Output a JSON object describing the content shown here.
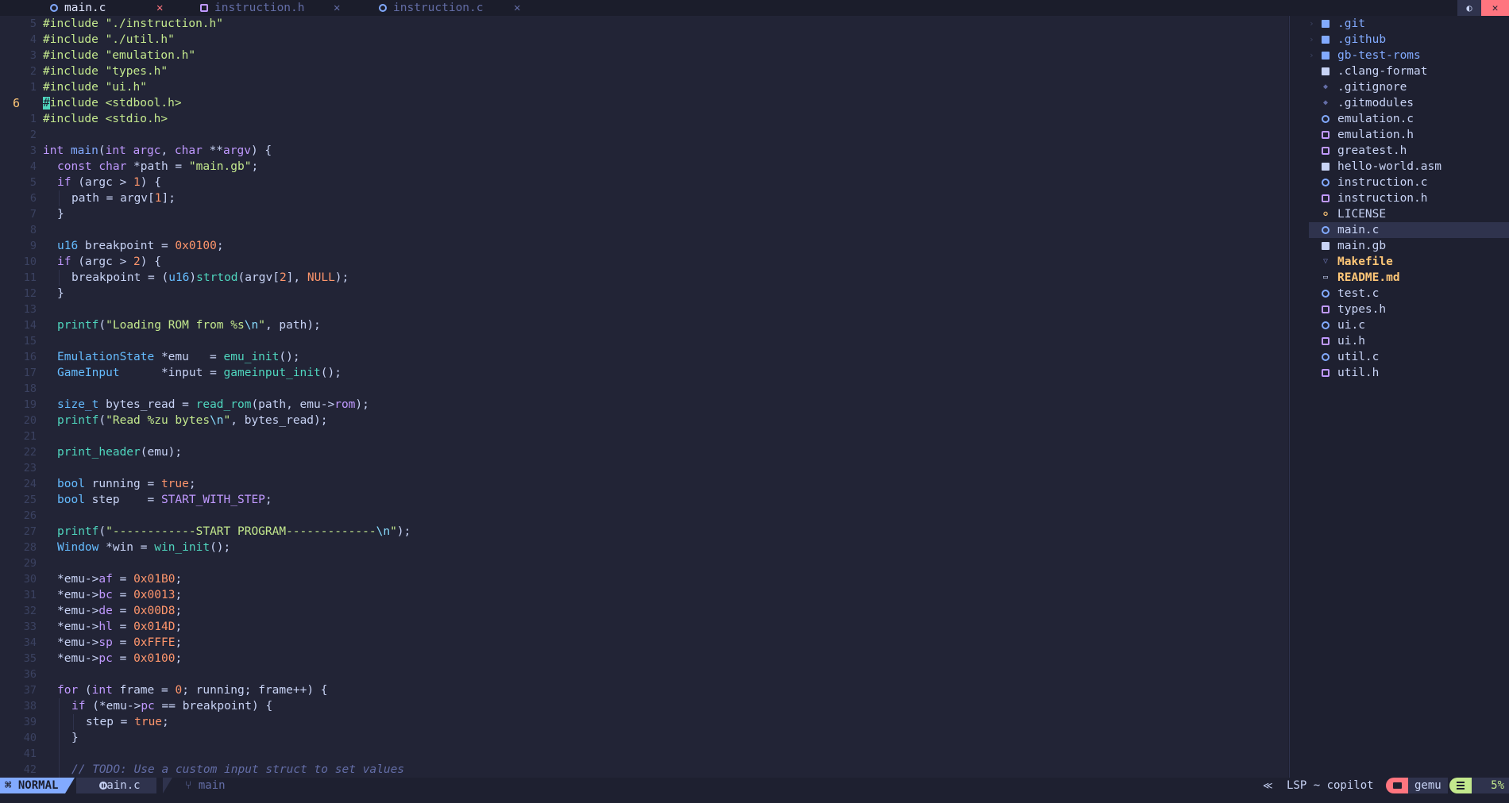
{
  "tabs": [
    {
      "label": "main.c",
      "close": "✕"
    },
    {
      "label": "instruction.h",
      "close": "✕"
    },
    {
      "label": "instruction.c",
      "close": "✕"
    }
  ],
  "tabline_buttons": [
    "◐",
    "✕"
  ],
  "current_line_number": "6",
  "gutter": [
    "5",
    "4",
    "3",
    "2",
    "1",
    "6",
    "1",
    "2",
    "3",
    "4",
    "5",
    "6",
    "7",
    "8",
    "9",
    "10",
    "11",
    "12",
    "13",
    "14",
    "15",
    "16",
    "17",
    "18",
    "19",
    "20",
    "21",
    "22",
    "23",
    "24",
    "25",
    "26",
    "27",
    "28",
    "29",
    "30",
    "31",
    "32",
    "33",
    "34",
    "35",
    "36",
    "37",
    "38",
    "39",
    "40",
    "41",
    "42"
  ],
  "code": {
    "l0": [
      "#include ",
      "\"./instruction.h\""
    ],
    "l1": [
      "#include ",
      "\"./util.h\""
    ],
    "l2": [
      "#include ",
      "\"emulation.h\""
    ],
    "l3": [
      "#include ",
      "\"types.h\""
    ],
    "l4": [
      "#include ",
      "\"ui.h\""
    ],
    "l5": [
      "#",
      "include ",
      "<stdbool.h>"
    ],
    "l6": [
      "#include ",
      "<stdio.h>"
    ],
    "l8": [
      "int",
      " ",
      "main",
      "(",
      "int",
      " ",
      "argc",
      ", ",
      "char",
      " **",
      "argv",
      ") {"
    ],
    "l9": [
      "const",
      " ",
      "char",
      " *path = ",
      "\"main.gb\"",
      ";"
    ],
    "l10": [
      "if",
      " (argc > ",
      "1",
      ") {"
    ],
    "l11": [
      "path = argv[",
      "1",
      "];"
    ],
    "l12": [
      "}"
    ],
    "l14": [
      "u16",
      " breakpoint = ",
      "0x0100",
      ";"
    ],
    "l15": [
      "if",
      " (argc > ",
      "2",
      ") {"
    ],
    "l16": [
      "breakpoint = (",
      "u16",
      ")",
      "strtod",
      "(argv[",
      "2",
      "], ",
      "NULL",
      ");"
    ],
    "l17": [
      "}"
    ],
    "l19": [
      "printf",
      "(",
      "\"Loading ROM from %s",
      "\\n",
      "\"",
      ", path);"
    ],
    "l21": [
      "EmulationState",
      " *emu   = ",
      "emu_init",
      "();"
    ],
    "l22": [
      "GameInput",
      "      *input = ",
      "gameinput_init",
      "();"
    ],
    "l24": [
      "size_t",
      " bytes_read = ",
      "read_rom",
      "(path, emu->",
      "rom",
      ");"
    ],
    "l25": [
      "printf",
      "(",
      "\"Read %zu bytes",
      "\\n",
      "\"",
      ", bytes_read);"
    ],
    "l27": [
      "print_header",
      "(emu);"
    ],
    "l29": [
      "bool",
      " running = ",
      "true",
      ";"
    ],
    "l30": [
      "bool",
      " step    = ",
      "START_WITH_STEP",
      ";"
    ],
    "l32": [
      "printf",
      "(",
      "\"------------START PROGRAM-------------",
      "\\n",
      "\"",
      ");"
    ],
    "l33": [
      "Window",
      " *win = ",
      "win_init",
      "();"
    ],
    "l35": [
      "*emu->",
      "af",
      " = ",
      "0x01B0",
      ";"
    ],
    "l36": [
      "*emu->",
      "bc",
      " = ",
      "0x0013",
      ";"
    ],
    "l37": [
      "*emu->",
      "de",
      " = ",
      "0x00D8",
      ";"
    ],
    "l38": [
      "*emu->",
      "hl",
      " = ",
      "0x014D",
      ";"
    ],
    "l39": [
      "*emu->",
      "sp",
      " = ",
      "0xFFFE",
      ";"
    ],
    "l40": [
      "*emu->",
      "pc",
      " = ",
      "0x0100",
      ";"
    ],
    "l42": [
      "for",
      " (",
      "int",
      " frame = ",
      "0",
      "; running; frame++) {"
    ],
    "l43": [
      "if",
      " (*emu->",
      "pc",
      " == breakpoint) {"
    ],
    "l44": [
      "step = ",
      "true",
      ";"
    ],
    "l45": [
      "}"
    ],
    "l47": [
      "// TODO: Use a custom input struct to set values"
    ]
  },
  "sidebar": {
    "items": [
      {
        "name": ".git",
        "icon": "folder-icon",
        "chevron": "›"
      },
      {
        "name": ".github",
        "icon": "folder-icon",
        "chevron": "›"
      },
      {
        "name": "gb-test-roms",
        "icon": "folder-icon",
        "chevron": "›"
      },
      {
        "name": ".clang-format",
        "icon": "file-icon"
      },
      {
        "name": ".gitignore",
        "icon": "git-icon"
      },
      {
        "name": ".gitmodules",
        "icon": "git-icon"
      },
      {
        "name": "emulation.c",
        "icon": "c-file-icon"
      },
      {
        "name": "emulation.h",
        "icon": "h-file-icon"
      },
      {
        "name": "greatest.h",
        "icon": "h-file-icon"
      },
      {
        "name": "hello-world.asm",
        "icon": "file-icon"
      },
      {
        "name": "instruction.c",
        "icon": "c-file-icon"
      },
      {
        "name": "instruction.h",
        "icon": "h-file-icon"
      },
      {
        "name": "LICENSE",
        "icon": "license-icon"
      },
      {
        "name": "main.c",
        "icon": "c-file-icon"
      },
      {
        "name": "main.gb",
        "icon": "file-icon"
      },
      {
        "name": "Makefile",
        "icon": "makefile-icon"
      },
      {
        "name": "README.md",
        "icon": "markdown-icon"
      },
      {
        "name": "test.c",
        "icon": "c-file-icon"
      },
      {
        "name": "types.h",
        "icon": "h-file-icon"
      },
      {
        "name": "ui.c",
        "icon": "c-file-icon"
      },
      {
        "name": "ui.h",
        "icon": "h-file-icon"
      },
      {
        "name": "util.c",
        "icon": "c-file-icon"
      },
      {
        "name": "util.h",
        "icon": "h-file-icon"
      }
    ]
  },
  "statusline": {
    "mode": "NORMAL",
    "mode_icon": "⌘",
    "file": "main.c",
    "branch_icon": "⑂",
    "branch": "main",
    "lsp_icon": "≪",
    "lsp": "LSP ~ copilot",
    "project": "gemu",
    "position": "5%"
  },
  "colors": {
    "background": "#222436",
    "keyword": "#c099ff",
    "type": "#65bcff",
    "string": "#c3e88d",
    "number": "#ff966c",
    "function": "#82aaff",
    "mode": "#82aaff"
  }
}
